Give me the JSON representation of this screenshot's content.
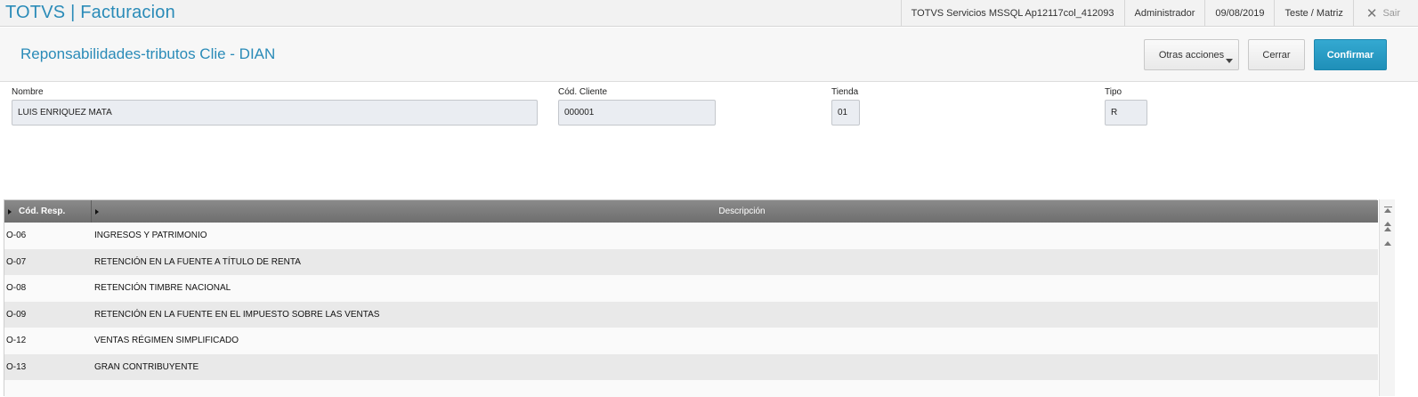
{
  "app": {
    "title": "TOTVS | Facturacion"
  },
  "topbar": {
    "environment": "TOTVS Servicios MSSQL Ap12117col_412093",
    "user": "Administrador",
    "date": "09/08/2019",
    "branch": "Teste / Matriz",
    "exit_label": "Sair"
  },
  "header": {
    "title": "Reponsabilidades-tributos Clie - DIAN",
    "other_actions_label": "Otras acciones",
    "close_label": "Cerrar",
    "confirm_label": "Confirmar"
  },
  "form": {
    "nombre": {
      "label": "Nombre",
      "value": "LUIS ENRIQUEZ MATA"
    },
    "cod_cliente": {
      "label": "Cód. Cliente",
      "value": "000001"
    },
    "tienda": {
      "label": "Tienda",
      "value": "01"
    },
    "tipo": {
      "label": "Tipo",
      "value": "R"
    }
  },
  "grid": {
    "columns": [
      "Cód. Resp.",
      "Descripción"
    ],
    "rows": [
      {
        "code": "O-06",
        "description": "INGRESOS Y PATRIMONIO"
      },
      {
        "code": "O-07",
        "description": "RETENCIÓN EN LA FUENTE A TÍTULO DE RENTA"
      },
      {
        "code": "O-08",
        "description": "RETENCIÓN TIMBRE NACIONAL"
      },
      {
        "code": "O-09",
        "description": "RETENCIÓN EN LA FUENTE EN EL IMPUESTO SOBRE LAS VENTAS"
      },
      {
        "code": "O-12",
        "description": "VENTAS RÉGIMEN SIMPLIFICADO"
      },
      {
        "code": "O-13",
        "description": "GRAN CONTRIBUYENTE"
      }
    ]
  },
  "icons": {
    "close": "close-icon",
    "sort": "sort-arrow-icon",
    "scroll_top": "scroll-top-icon",
    "scroll_page_up": "scroll-page-up-icon",
    "scroll_up": "scroll-up-icon"
  },
  "colors": {
    "brand": "#2a8bb8",
    "confirm": "#1f8fb8",
    "grid_header": "#7a7a7a"
  }
}
